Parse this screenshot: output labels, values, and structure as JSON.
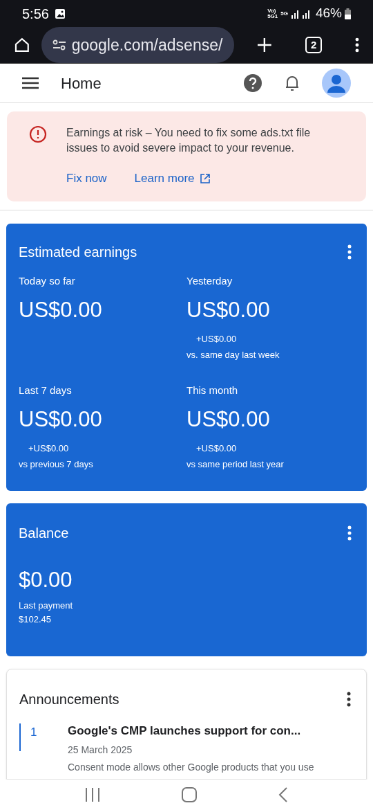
{
  "status_bar": {
    "time": "5:56",
    "indicators": [
      "Vo)\n5G1",
      "5G"
    ],
    "battery": "46%"
  },
  "browser": {
    "url": "google.com/adsense/",
    "tab_count": "2"
  },
  "header": {
    "title": "Home"
  },
  "alert": {
    "message": "Earnings at risk – You need to fix some ads.txt file issues to avoid severe impact to your revenue.",
    "actions": [
      {
        "label": "Fix now",
        "external": false
      },
      {
        "label": "Learn more",
        "external": true
      }
    ]
  },
  "earnings": {
    "title": "Estimated earnings",
    "metrics": [
      {
        "label": "Today so far",
        "value": "US$0.00"
      },
      {
        "label": "Yesterday",
        "value": "US$0.00",
        "change": "+US$0.00",
        "comparison": "vs. same day last week"
      },
      {
        "label": "Last 7 days",
        "value": "US$0.00",
        "change": "+US$0.00",
        "comparison": "vs previous 7 days"
      },
      {
        "label": "This month",
        "value": "US$0.00",
        "change": "+US$0.00",
        "comparison": "vs same period last year"
      }
    ]
  },
  "balance": {
    "title": "Balance",
    "value": "$0.00",
    "last_payment_label": "Last payment",
    "last_payment": "$102.45"
  },
  "announcements": {
    "title": "Announcements",
    "items": [
      {
        "number": "1",
        "title": "Google's CMP launches support for con...",
        "date": "25 March 2025",
        "summary": "Consent mode allows other Google products that you use"
      }
    ]
  }
}
